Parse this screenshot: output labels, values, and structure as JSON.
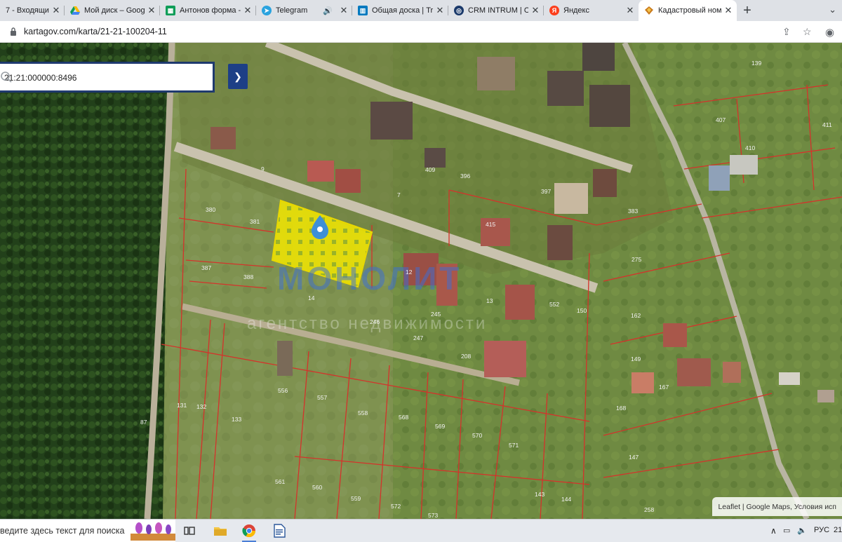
{
  "tabs": [
    {
      "title": "7 - Входящие -",
      "favicon": "gmail-icon",
      "active": false
    },
    {
      "title": "Мой диск – Goog",
      "favicon": "google-drive-icon",
      "active": false
    },
    {
      "title": "Антонов форма -",
      "favicon": "google-sheets-icon",
      "active": false
    },
    {
      "title": "Telegram",
      "favicon": "telegram-icon",
      "active": false
    },
    {
      "title": "Общая доска | Tr",
      "favicon": "trello-icon",
      "active": false
    },
    {
      "title": "CRM INTRUM | Об",
      "favicon": "crm-intrum-icon",
      "active": false
    },
    {
      "title": "Яндекс",
      "favicon": "yandex-icon",
      "active": false
    },
    {
      "title": "Кадастровый ном",
      "favicon": "cadastre-icon",
      "active": true
    }
  ],
  "address_bar": {
    "url": "kartagov.com/karta/21-21-100204-11"
  },
  "map": {
    "search": {
      "value": "21:21:000000:8496",
      "placeholder": ""
    },
    "attribution": "Leaflet | Google Maps, Условия исп",
    "watermark": {
      "line1": "МОНОЛИТ",
      "line2": "агентство недвижимости"
    },
    "parcel_labels": [
      "139",
      "407",
      "411",
      "410",
      "409",
      "396",
      "397",
      "383",
      "380",
      "381",
      "387",
      "388",
      "14",
      "12",
      "13",
      "245",
      "246",
      "247",
      "208",
      "552",
      "150",
      "415",
      "275",
      "162",
      "149",
      "167",
      "168",
      "147",
      "258",
      "133",
      "131",
      "132",
      "87",
      "556",
      "557",
      "558",
      "568",
      "569",
      "570",
      "571",
      "561",
      "560",
      "559",
      "572",
      "573",
      "144",
      "143",
      "7",
      "9",
      "275"
    ],
    "colors": {
      "selected_parcel": "#f2e600",
      "parcel_border": "#d4332b",
      "marker": "#3d8fd6"
    }
  },
  "taskbar": {
    "search_placeholder": "ведите здесь текст для поиска",
    "tray_lang": "РУС",
    "tray_time": "21"
  }
}
